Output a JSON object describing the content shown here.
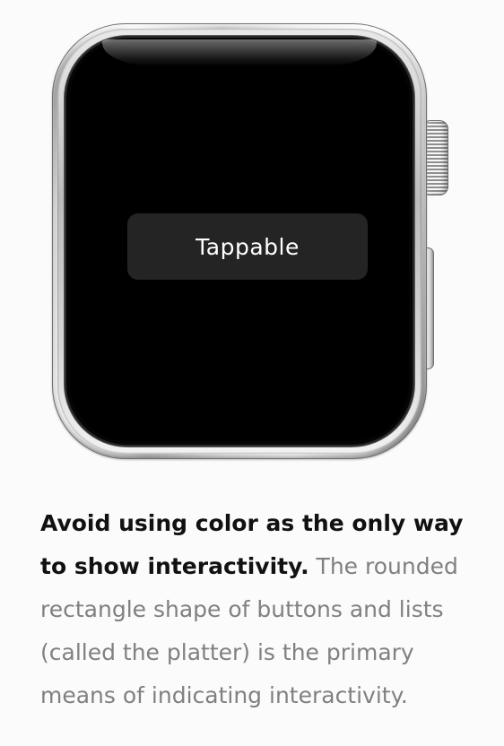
{
  "watch": {
    "platter_label": "Tappable"
  },
  "caption": {
    "lead": "Avoid using color as the only way to show interactivity.",
    "body": " The rounded rectangle shape of buttons and lists (called the platter) is the primary means of indicating interactivity."
  },
  "colors": {
    "background": "#fbfbfb",
    "screen": "#000000",
    "platter": "#242424",
    "platter_text": "#ffffff",
    "caption_lead": "#111111",
    "caption_body": "#808080"
  }
}
